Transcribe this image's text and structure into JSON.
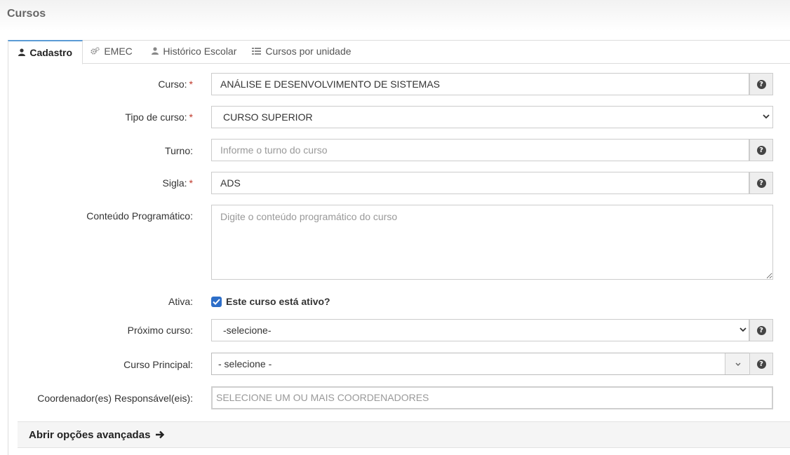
{
  "page": {
    "title": "Cursos"
  },
  "tabs": [
    {
      "label": "Cadastro",
      "icon": "user-icon",
      "active": true
    },
    {
      "label": "EMEC",
      "icon": "cogs-icon",
      "active": false
    },
    {
      "label": "Histórico Escolar",
      "icon": "user-icon",
      "active": false
    },
    {
      "label": "Cursos por unidade",
      "icon": "list-icon",
      "active": false
    }
  ],
  "form": {
    "curso": {
      "label": "Curso:",
      "required_mark": "*",
      "value": "ANÁLISE E DESENVOLVIMENTO DE SISTEMAS"
    },
    "tipo": {
      "label": "Tipo de curso:",
      "required_mark": "*",
      "value": "CURSO SUPERIOR"
    },
    "turno": {
      "label": "Turno:",
      "placeholder": "Informe o turno do curso"
    },
    "sigla": {
      "label": "Sigla:",
      "required_mark": "*",
      "value": "ADS"
    },
    "conteudo": {
      "label": "Conteúdo Programático:",
      "placeholder": "Digite o conteúdo programático do curso"
    },
    "ativa": {
      "label": "Ativa:",
      "checkbox_label": "Este curso está ativo?",
      "checked": true
    },
    "proximo": {
      "label": "Próximo curso:",
      "value": "-selecione-"
    },
    "principal": {
      "label": "Curso Principal:",
      "value": "- selecione -"
    },
    "coordenador": {
      "label": "Coordenador(es) Responsável(eis):",
      "placeholder": "SELECIONE UM OU MAIS COORDENADORES"
    }
  },
  "advanced": {
    "label": "Abrir opções avançadas"
  },
  "help_icon_glyph": "?",
  "colors": {
    "accent": "#2d6ec8",
    "required": "#c0392b",
    "tab_active_border": "#5b9bd5"
  }
}
